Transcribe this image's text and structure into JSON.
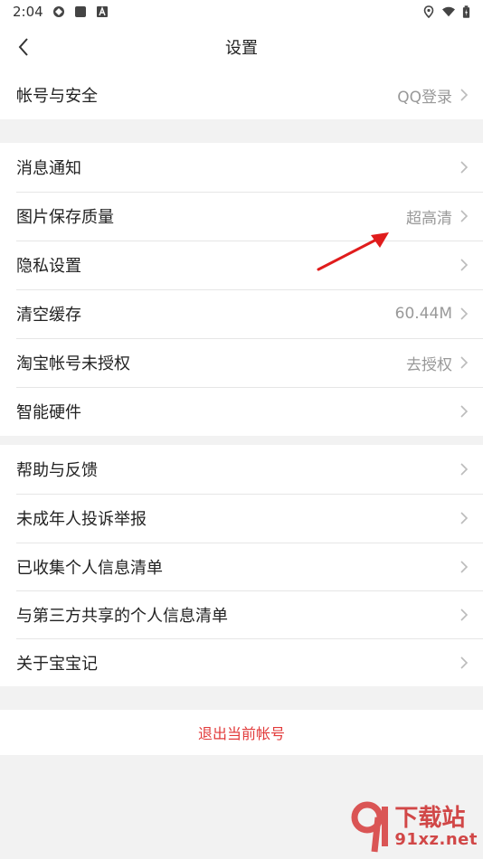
{
  "status_bar": {
    "time": "2:04"
  },
  "header": {
    "title": "设置"
  },
  "groups": [
    [
      {
        "label": "帐号与安全",
        "value": "QQ登录"
      }
    ],
    [
      {
        "label": "消息通知",
        "value": ""
      },
      {
        "label": "图片保存质量",
        "value": "超高清"
      },
      {
        "label": "隐私设置",
        "value": ""
      },
      {
        "label": "清空缓存",
        "value": "60.44M"
      },
      {
        "label": "淘宝帐号未授权",
        "value": "去授权"
      },
      {
        "label": "智能硬件",
        "value": ""
      }
    ],
    [
      {
        "label": "帮助与反馈",
        "value": ""
      },
      {
        "label": "未成年人投诉举报",
        "value": ""
      },
      {
        "label": "已收集个人信息清单",
        "value": ""
      },
      {
        "label": "与第三方共享的个人信息清单",
        "value": ""
      },
      {
        "label": "关于宝宝记",
        "value": ""
      }
    ]
  ],
  "logout": {
    "label": "退出当前帐号"
  },
  "watermark": {
    "top": "下载站",
    "bottom": "91xz.net"
  },
  "colors": {
    "background": "#f2f2f2",
    "logout": "#e23b3b",
    "annotation_arrow": "#e01c1c"
  }
}
